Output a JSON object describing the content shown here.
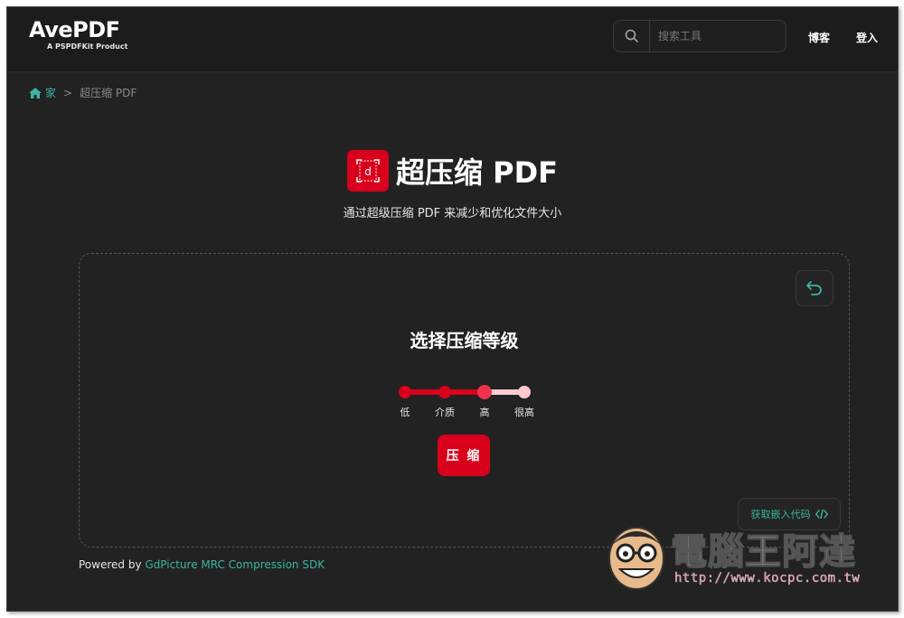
{
  "brand": {
    "logo_main_prefix": "Av",
    "logo_main_e": "e",
    "logo_main_suffix": "PDF",
    "logo_sub": "A PSPDFKit Product"
  },
  "header": {
    "search_placeholder": "搜索工具",
    "nav": [
      "博客",
      "登入"
    ]
  },
  "breadcrumb": {
    "home": "家",
    "separator": ">",
    "current": "超压缩 PDF"
  },
  "page": {
    "title": "超压缩 PDF",
    "subtitle": "通过超级压缩 PDF 来减少和优化文件大小"
  },
  "panel": {
    "heading": "选择压缩等级",
    "levels": [
      "低",
      "介质",
      "高",
      "很高"
    ],
    "selected_level": "高",
    "compress_label": "压 缩",
    "embed_label": "获取嵌入代码",
    "embed_icon": "code-icon"
  },
  "footer": {
    "powered_by": "Powered by",
    "sdk_link": "GdPicture MRC Compression SDK"
  },
  "watermark": {
    "text": "電腦王阿達",
    "url": "http://www.kocpc.com.tw"
  },
  "colors": {
    "background": "#222222",
    "accent_red": "#d9001b",
    "accent_teal": "#3cb3a3",
    "slider_light": "#ffc9cf"
  }
}
